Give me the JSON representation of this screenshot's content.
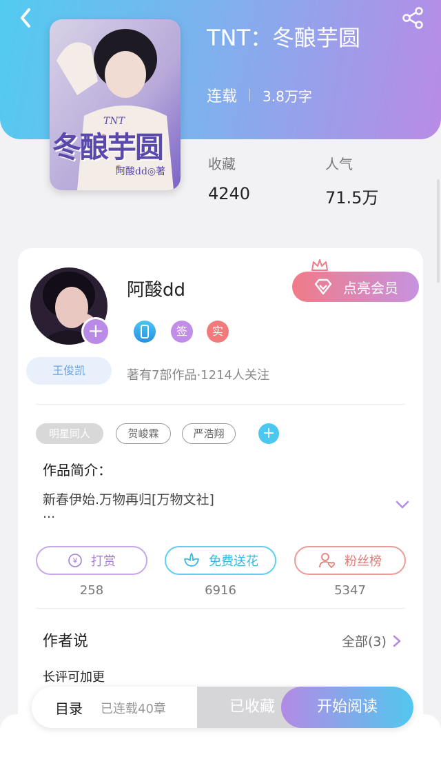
{
  "header": {
    "book_title": "TNT：冬酿芋圆",
    "status": "连载",
    "word_count": "3.8万字",
    "cover_title": "冬酿芋圆",
    "cover_series": "TNT",
    "cover_author": "阿酸dd◎著"
  },
  "stats": [
    {
      "label": "收藏",
      "value": "4240"
    },
    {
      "label": "人气",
      "value": "71.5万"
    }
  ],
  "author": {
    "name": "阿酸dd",
    "badges": {
      "sign": "签",
      "real": "实"
    },
    "fan_tag": "王俊凯",
    "works_summary": "著有7部作品·1214人关注",
    "add_symbol": "+"
  },
  "vip": {
    "label": "点亮会员"
  },
  "tags": [
    "明星同人",
    "贺峻霖",
    "严浩翔"
  ],
  "intro": {
    "title": "作品简介：",
    "text": "新春伊始.万物再归[万物文社]",
    "ellipsis": "..."
  },
  "actions": [
    {
      "label": "打赏",
      "count": "258",
      "icon": "yen-icon"
    },
    {
      "label": "免费送花",
      "count": "6916",
      "icon": "flower-icon"
    },
    {
      "label": "粉丝榜",
      "count": "5347",
      "icon": "user-heart-icon"
    }
  ],
  "author_says": {
    "title": "作者说",
    "view_all": "全部(3)",
    "preview": "长评可加更"
  },
  "bottom_bar": {
    "toc": "目录",
    "toc_status": "已连载40章",
    "collected": "已收藏",
    "start_reading": "开始阅读"
  },
  "colors": {
    "header_gradient_start": "#52cbf0",
    "header_gradient_end": "#b98be6",
    "vip_gradient_start": "#f07b87",
    "vip_gradient_end": "#c792e0",
    "read_gradient_start": "#b38ae6",
    "read_gradient_end": "#52c7ef"
  }
}
